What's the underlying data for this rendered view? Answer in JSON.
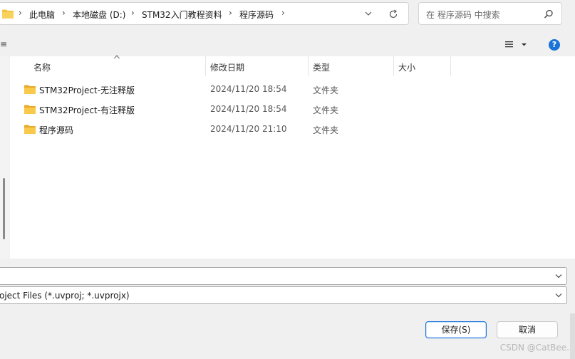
{
  "breadcrumb": {
    "items": [
      "此电脑",
      "本地磁盘 (D:)",
      "STM32入门教程资料",
      "程序源码"
    ]
  },
  "search": {
    "placeholder": "在 程序源码 中搜索"
  },
  "toolbar": {
    "left_partial": "≡",
    "help_label": "?"
  },
  "columns": {
    "name": "名称",
    "modified": "修改日期",
    "type": "类型",
    "size": "大小"
  },
  "files": [
    {
      "name": "STM32Project-无注释版",
      "modified": "2024/11/20 18:54",
      "type": "文件夹"
    },
    {
      "name": "STM32Project-有注释版",
      "modified": "2024/11/20 18:54",
      "type": "文件夹"
    },
    {
      "name": "程序源码",
      "modified": "2024/11/20 21:10",
      "type": "文件夹"
    }
  ],
  "filename_field": {
    "value": ""
  },
  "filetype_field": {
    "value": "oject Files (*.uvproj; *.uvprojx)"
  },
  "buttons": {
    "save": "保存(S)",
    "cancel": "取消"
  },
  "watermark": "CSDN @CatBee.",
  "colors": {
    "accent": "#1a73d8",
    "folder": "#f5c342"
  },
  "icons": [
    "folder-icon",
    "chevron-right-icon",
    "chevron-down-icon",
    "refresh-icon",
    "search-icon",
    "view-list-icon",
    "help-icon",
    "sort-up-icon"
  ]
}
